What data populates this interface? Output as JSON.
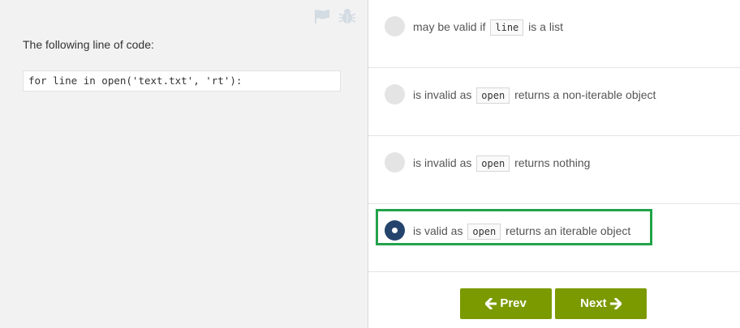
{
  "question": {
    "prompt": "The following line of code:",
    "code": "for line in open('text.txt', 'rt'):"
  },
  "toolbar": {
    "flag_icon": "flag-icon",
    "bug_icon": "bug-icon"
  },
  "options": [
    {
      "before": "may be valid if",
      "code": "line",
      "after": "is a list",
      "selected": false
    },
    {
      "before": "is invalid as",
      "code": "open",
      "after": "returns a non-iterable object",
      "selected": false
    },
    {
      "before": "is invalid as",
      "code": "open",
      "after": "returns nothing",
      "selected": false
    },
    {
      "before": "is valid as",
      "code": "open",
      "after": "returns an iterable object",
      "selected": true
    }
  ],
  "nav": {
    "prev_label": "Prev",
    "next_label": "Next"
  },
  "colors": {
    "button": "#7b9a00",
    "radio_selected": "#24446d",
    "highlight_frame": "#22a34a"
  }
}
